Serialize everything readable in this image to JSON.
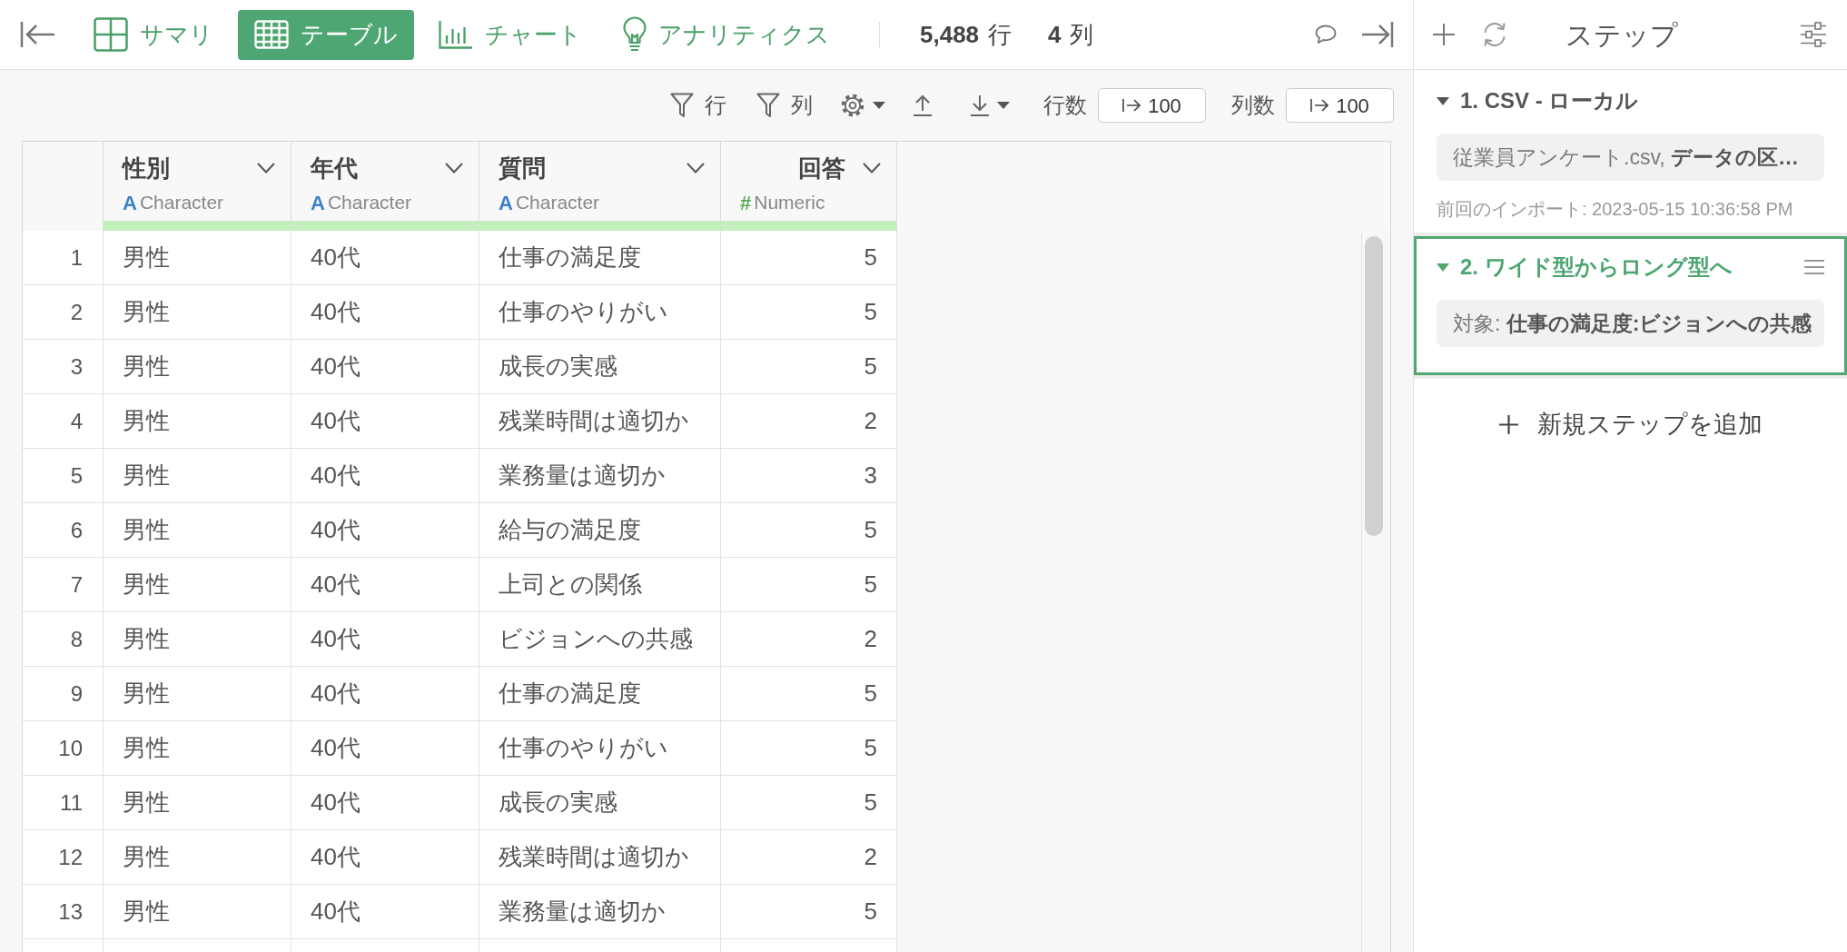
{
  "top_bar": {
    "tabs": [
      {
        "label": "サマリ",
        "kind": "summary",
        "selected": false
      },
      {
        "label": "テーブル",
        "kind": "table",
        "selected": true
      },
      {
        "label": "チャート",
        "kind": "chart",
        "selected": false
      },
      {
        "label": "アナリティクス",
        "kind": "analytics",
        "selected": false
      }
    ],
    "row_count": {
      "value": "5,488",
      "unit": "行"
    },
    "column_count": {
      "value": "4",
      "unit": "列"
    }
  },
  "toolbar": {
    "row_filter": "行",
    "column_filter": "列",
    "row_limit": {
      "label": "行数",
      "value": "100"
    },
    "column_limit": {
      "label": "列数",
      "value": "100"
    }
  },
  "table": {
    "columns": [
      {
        "title": "性別",
        "type": "Character",
        "type_mark": "A",
        "kind": "character",
        "level": 1
      },
      {
        "title": "年代",
        "type": "Character",
        "type_mark": "A",
        "kind": "character",
        "level": 1
      },
      {
        "title": "質問",
        "type": "Character",
        "type_mark": "A",
        "kind": "character",
        "level": 1
      },
      {
        "title": "回答",
        "type": "Numeric",
        "type_mark": "#",
        "kind": "numeric",
        "level": 1
      }
    ],
    "rows": [
      {
        "number": "1",
        "cells": [
          "男性",
          "40代",
          "仕事の満足度",
          "5"
        ]
      },
      {
        "number": "2",
        "cells": [
          "男性",
          "40代",
          "仕事のやりがい",
          "5"
        ]
      },
      {
        "number": "3",
        "cells": [
          "男性",
          "40代",
          "成長の実感",
          "5"
        ]
      },
      {
        "number": "4",
        "cells": [
          "男性",
          "40代",
          "残業時間は適切か",
          "2"
        ]
      },
      {
        "number": "5",
        "cells": [
          "男性",
          "40代",
          "業務量は適切か",
          "3"
        ]
      },
      {
        "number": "6",
        "cells": [
          "男性",
          "40代",
          "給与の満足度",
          "5"
        ]
      },
      {
        "number": "7",
        "cells": [
          "男性",
          "40代",
          "上司との関係",
          "5"
        ]
      },
      {
        "number": "8",
        "cells": [
          "男性",
          "40代",
          "ビジョンへの共感",
          "2"
        ]
      },
      {
        "number": "9",
        "cells": [
          "男性",
          "40代",
          "仕事の満足度",
          "5"
        ]
      },
      {
        "number": "10",
        "cells": [
          "男性",
          "40代",
          "仕事のやりがい",
          "5"
        ]
      },
      {
        "number": "11",
        "cells": [
          "男性",
          "40代",
          "成長の実感",
          "5"
        ]
      },
      {
        "number": "12",
        "cells": [
          "男性",
          "40代",
          "残業時間は適切か",
          "2"
        ]
      },
      {
        "number": "13",
        "cells": [
          "男性",
          "40代",
          "業務量は適切か",
          "5"
        ]
      }
    ]
  },
  "steps_panel": {
    "title": "ステップ",
    "steps": [
      {
        "title": "1. CSV - ローカル",
        "expanded": true,
        "selected": false,
        "summary": "従業員アンケート.csv, **データの区…**",
        "note": "前回のインポート: 2023-05-15 10:36:58 PM"
      },
      {
        "title": "2. ワイド型からロング型へ",
        "expanded": true,
        "selected": true,
        "summary": "対象: **仕事の満足度:ビジョンへの共感**"
      }
    ],
    "add_step": "新規ステップを追加"
  }
}
